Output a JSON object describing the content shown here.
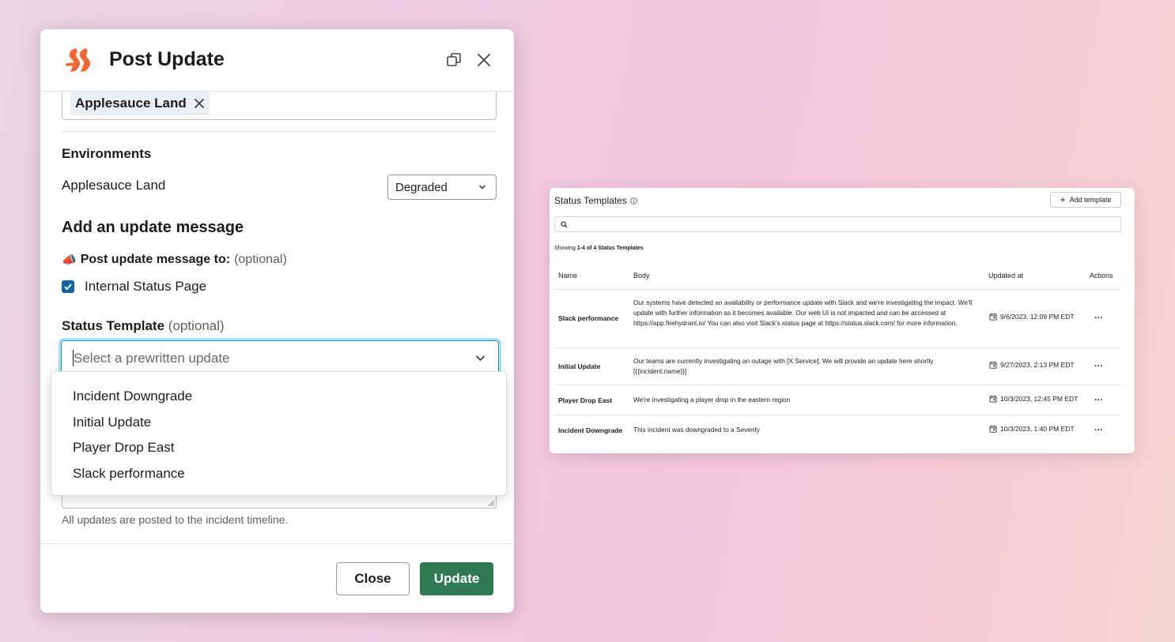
{
  "modal": {
    "title": "Post Update",
    "logo_icon": "firehydrant-logo",
    "tag": "Applesauce Land",
    "environments": {
      "heading": "Environments",
      "name": "Applesauce Land",
      "status": "Degraded"
    },
    "message_heading": "Add an update message",
    "post_to": {
      "emoji": "📣",
      "label": "Post update message to:",
      "optional": "(optional)"
    },
    "checkbox_label": "Internal Status Page",
    "checkbox_checked": true,
    "template": {
      "label": "Status Template",
      "optional": "(optional)",
      "placeholder": "Select a prewritten update",
      "options": [
        "Incident Downgrade",
        "Initial Update",
        "Player Drop East",
        "Slack performance"
      ]
    },
    "hint": "All updates are posted to the incident timeline.",
    "close_label": "Close",
    "update_label": "Update",
    "update_color": "#2f7a52"
  },
  "panel": {
    "title": "Status Templates",
    "add_label": "Add template",
    "showing_prefix": "Showing ",
    "showing_bold": "1-4 of 4 Status Templates",
    "columns": {
      "name": "Name",
      "body": "Body",
      "updated": "Updated at",
      "actions": "Actions"
    },
    "rows": [
      {
        "name": "Slack performance",
        "body": "Our systems have detected an availability or performance update with Slack and we're investigating the impact. We'll update with further information as it becomes available. Our web UI is not impacted and can be accessed at https://app.firehydrant.io/ You can also visit Slack's status page at https://status.slack.com/ for more information.",
        "updated": "9/6/2023, 12:09 PM EDT",
        "actions": "..."
      },
      {
        "name": "Initial Update",
        "body": "Our teams are currently investigating an outage with [X Service]. We will provide an update here shortly [{{incident.name}}]",
        "updated": "9/27/2023, 2:13 PM EDT",
        "actions": "..."
      },
      {
        "name": "Player Drop East",
        "body": "We're investigating a player drop in the eastern region",
        "updated": "10/3/2023, 12:45 PM EDT",
        "actions": "..."
      },
      {
        "name": "Incident Downgrade",
        "body": "This incident was downgraded to a Severity",
        "updated": "10/3/2023, 1:40 PM EDT",
        "actions": "..."
      }
    ]
  }
}
